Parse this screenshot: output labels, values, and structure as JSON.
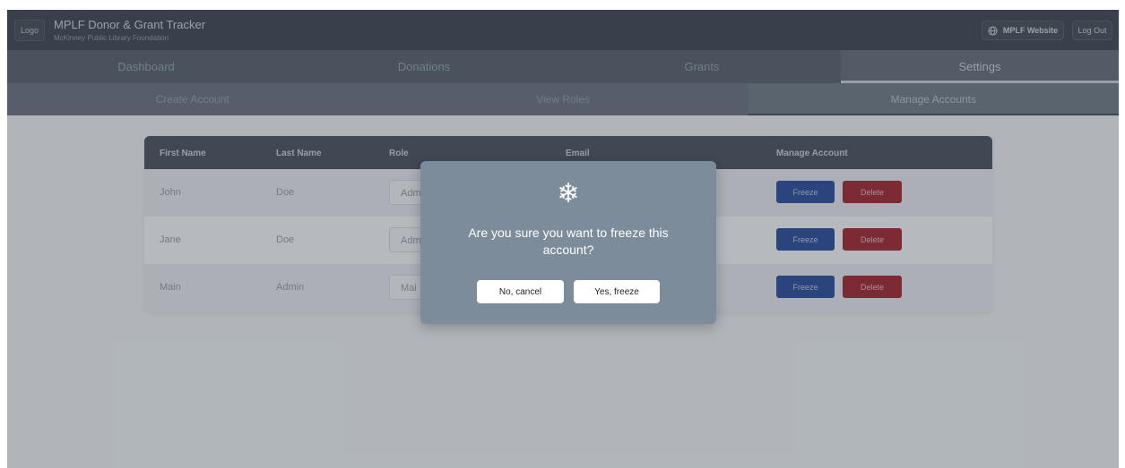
{
  "header": {
    "logo_text": "Logo",
    "title": "MPLF Donor & Grant Tracker",
    "subtitle": "McKinney Public Library Foundation",
    "website_label": "MPLF Website",
    "logout_label": "Log Out"
  },
  "tabs": [
    "Dashboard",
    "Donations",
    "Grants",
    "Settings"
  ],
  "subtabs": [
    "Create Account",
    "View Roles",
    "Manage Accounts"
  ],
  "table": {
    "headers": [
      "First Name",
      "Last Name",
      "Role",
      "Email",
      "Manage Account"
    ],
    "rows": [
      {
        "first": "John",
        "last": "Doe",
        "role": "Adm",
        "freeze": "Freeze",
        "delete": "Delete"
      },
      {
        "first": "Jane",
        "last": "Doe",
        "role": "Adm",
        "freeze": "Freeze",
        "delete": "Delete"
      },
      {
        "first": "Main",
        "last": "Admin",
        "role": "Mai",
        "freeze": "Freeze",
        "delete": "Delete"
      }
    ]
  },
  "modal": {
    "icon": "snowflake-icon",
    "message": "Are you sure you want to freeze this account?",
    "cancel_label": "No, cancel",
    "confirm_label": "Yes, freeze"
  },
  "colors": {
    "header_bg": "#333a44",
    "freeze_button": "#1d3f91",
    "delete_button": "#9a1a22",
    "modal_bg": "#7c8c9b"
  }
}
